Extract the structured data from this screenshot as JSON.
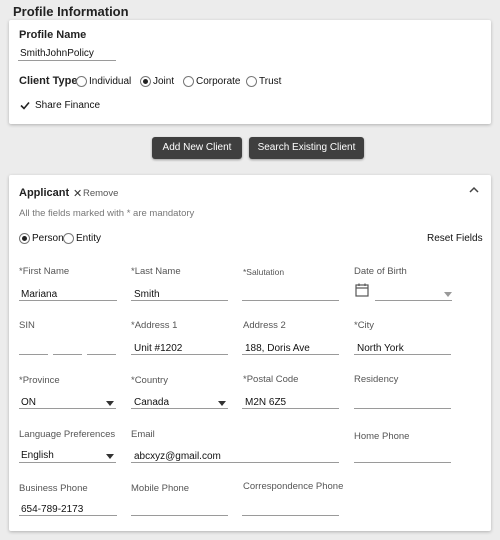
{
  "profile_section": {
    "title": "Profile Information"
  },
  "profile": {
    "name_label": "Profile Name",
    "name_value": "SmithJohnPolicy",
    "client_type_label": "Client Type:",
    "client_types": [
      "Individual",
      "Joint",
      "Corporate",
      "Trust"
    ],
    "selected_client_type": "Joint",
    "share_finance_label": "Share Finance",
    "share_finance_checked": true
  },
  "actions": {
    "add_new_client": "Add New Client",
    "search_existing_client": "Search Existing Client"
  },
  "applicant": {
    "title": "Applicant",
    "remove_label": "Remove",
    "mandatory_note": "All the fields marked with * are mandatory",
    "entity_types": [
      "Person",
      "Entity"
    ],
    "selected_entity": "Person",
    "reset_label": "Reset Fields",
    "fields": {
      "first_name": {
        "label": "*First Name",
        "value": "Mariana"
      },
      "last_name": {
        "label": "*Last Name",
        "value": "Smith"
      },
      "salutation": {
        "label": "*Salutation",
        "value": ""
      },
      "dob": {
        "label": "Date of Birth",
        "value": ""
      },
      "sin": {
        "label": "SIN",
        "value": ""
      },
      "address1": {
        "label": "*Address 1",
        "value": "Unit #1202"
      },
      "address2": {
        "label": "Address 2",
        "value": "188, Doris Ave"
      },
      "city": {
        "label": "*City",
        "value": "North York"
      },
      "province": {
        "label": "*Province",
        "value": "ON"
      },
      "country": {
        "label": "*Country",
        "value": "Canada"
      },
      "postal_code": {
        "label": "*Postal Code",
        "value": "M2N 6Z5"
      },
      "residency": {
        "label": "Residency",
        "value": ""
      },
      "language": {
        "label": "Language Preferences",
        "value": "English"
      },
      "email": {
        "label": "Email",
        "value": "abcxyz@gmail.com"
      },
      "home_phone": {
        "label": "Home Phone",
        "value": ""
      },
      "business_phone": {
        "label": "Business Phone",
        "value": "654-789-2173"
      },
      "mobile_phone": {
        "label": "Mobile Phone",
        "value": ""
      },
      "correspondence_phone": {
        "label": "Correspondence Phone",
        "value": ""
      }
    }
  }
}
